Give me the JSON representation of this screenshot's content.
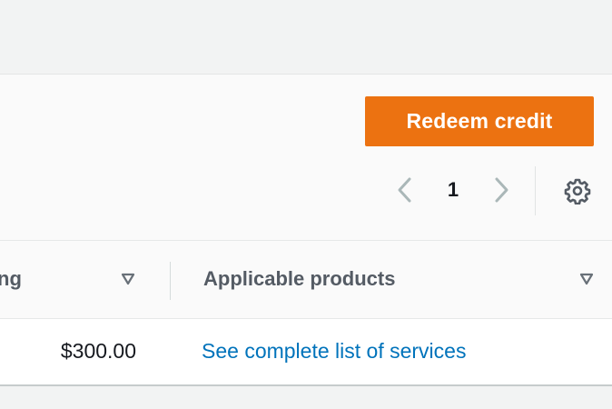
{
  "toolbar": {
    "redeem_label": "Redeem credit"
  },
  "pagination": {
    "current_page": "1",
    "prev_icon": "chevron-left-icon",
    "next_icon": "chevron-right-icon",
    "settings_icon": "gear-icon"
  },
  "table": {
    "columns": [
      {
        "label": "ng",
        "sort_icon": "sort-down-triangle-icon"
      },
      {
        "label": "Applicable products",
        "sort_icon": "sort-down-triangle-icon"
      }
    ],
    "rows": [
      {
        "amount": "$300.00",
        "products_link": "See complete list of services"
      }
    ]
  },
  "colors": {
    "accent": "#ec7211",
    "link": "#0073bb",
    "header_text": "#545b64",
    "body_text": "#16191f",
    "icon_muted": "#95a5a6"
  }
}
